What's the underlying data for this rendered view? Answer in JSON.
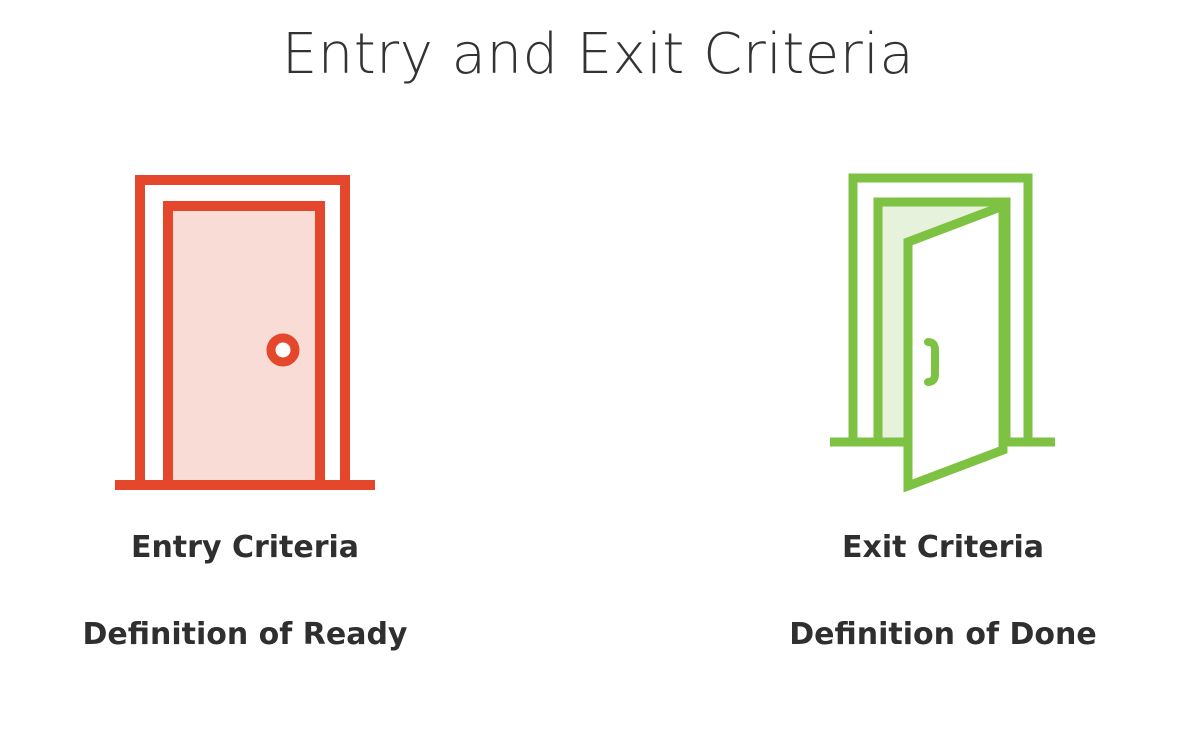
{
  "title": "Entry and Exit Criteria",
  "colors": {
    "entry_accent": "#e4472b",
    "entry_fill": "#f8dcd5",
    "exit_accent": "#7dc242",
    "exit_fill": "#e6f2dc",
    "text": "#333333"
  },
  "entry": {
    "icon": "closed-door-icon",
    "label": "Entry Criteria",
    "definition": "Definition of Ready"
  },
  "exit": {
    "icon": "open-door-icon",
    "label": "Exit Criteria",
    "definition": "Definition of Done"
  }
}
